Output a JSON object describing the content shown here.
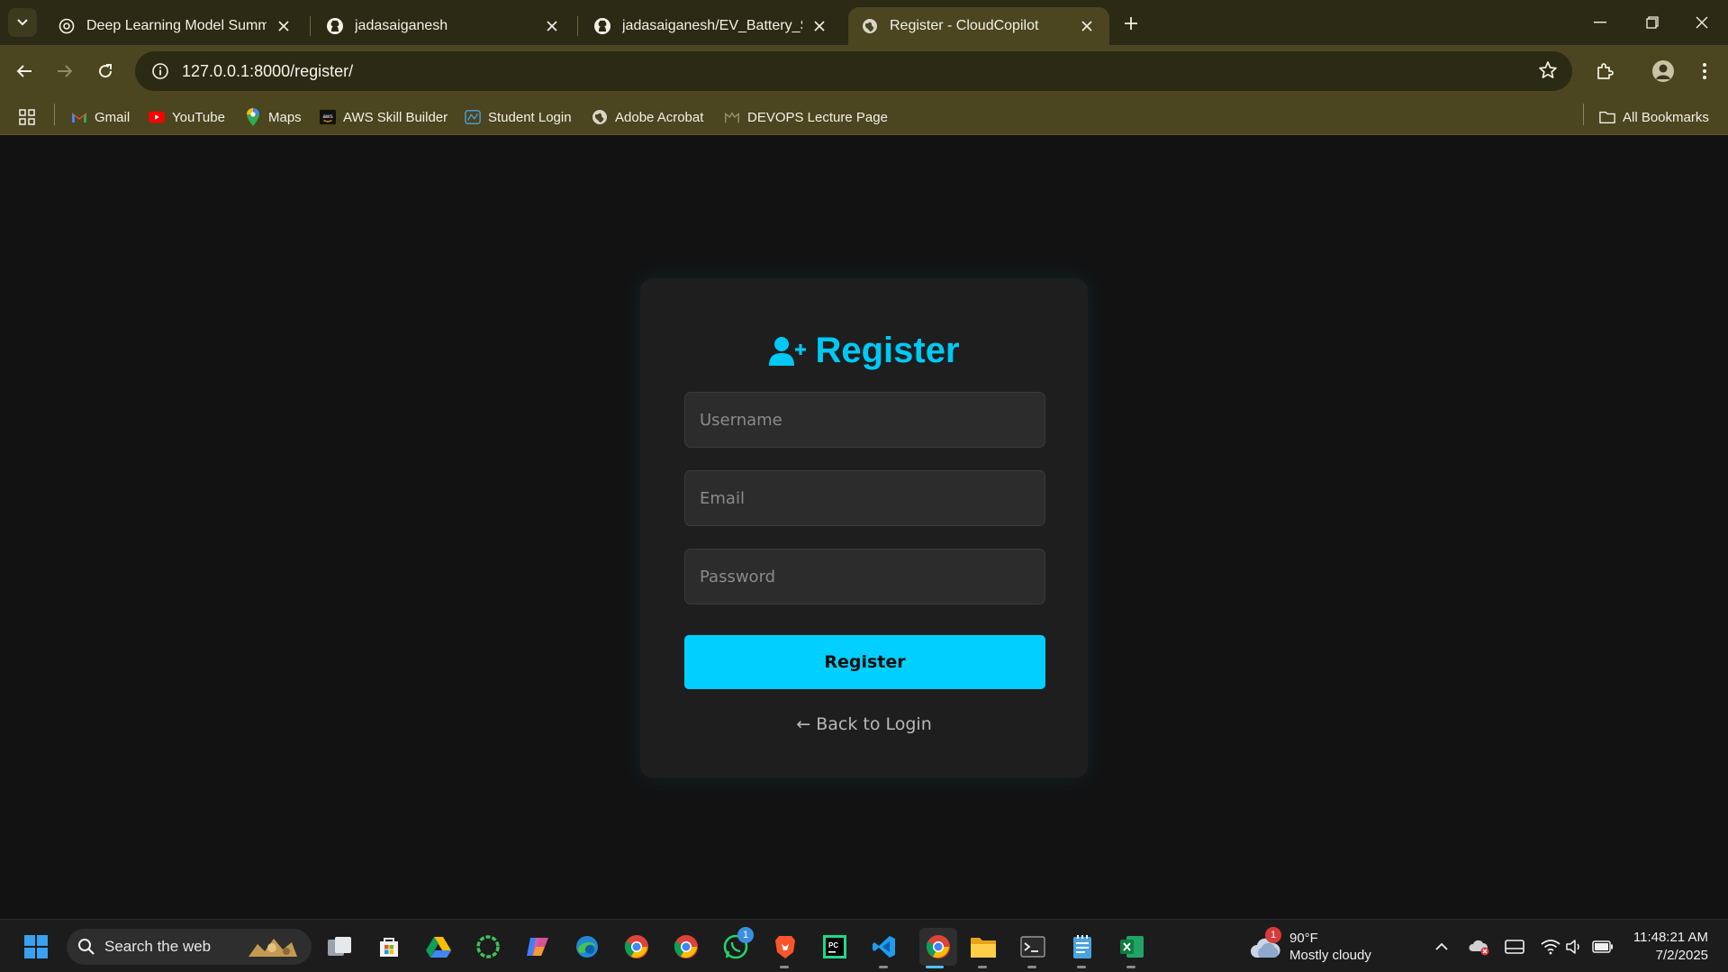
{
  "browser": {
    "tabs": [
      {
        "title": "Deep Learning Model Summary",
        "icon": "openai-icon",
        "active": false
      },
      {
        "title": "jadasaiganesh",
        "icon": "github-icon",
        "active": false
      },
      {
        "title": "jadasaiganesh/EV_Battery_SOH",
        "icon": "github-icon",
        "active": false
      },
      {
        "title": "Register - CloudCopilot",
        "icon": "globe-icon",
        "active": true
      }
    ],
    "url": "127.0.0.1:8000/register/",
    "bookmarks": [
      {
        "label": "Gmail",
        "icon": "gmail-icon"
      },
      {
        "label": "YouTube",
        "icon": "youtube-icon"
      },
      {
        "label": "Maps",
        "icon": "maps-icon"
      },
      {
        "label": "AWS Skill Builder",
        "icon": "aws-icon"
      },
      {
        "label": "Student Login",
        "icon": "student-icon"
      },
      {
        "label": "Adobe Acrobat",
        "icon": "globe-icon"
      },
      {
        "label": "DEVOPS Lecture Page",
        "icon": "moodle-icon"
      }
    ],
    "all_bookmarks_label": "All Bookmarks",
    "chrome_color": "#4b4520"
  },
  "register": {
    "title": "Register",
    "username_placeholder": "Username",
    "email_placeholder": "Email",
    "password_placeholder": "Password",
    "submit_label": "Register",
    "back_link": "← Back to Login",
    "accent_color": "#00cfff"
  },
  "taskbar": {
    "search_placeholder": "Search the web",
    "whatsapp_badge": "1",
    "weather_badge": "1",
    "weather_temp": "90°F",
    "weather_desc": "Mostly cloudy",
    "time": "11:48:21 AM",
    "date": "7/2/2025"
  }
}
